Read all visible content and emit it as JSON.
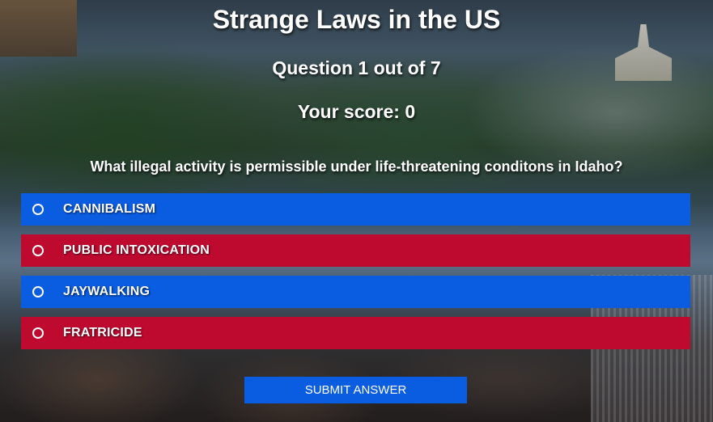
{
  "quiz": {
    "title": "Strange Laws in the US",
    "question_count": "Question 1 out of 7",
    "score": "Your score: 0",
    "question": "What illegal activity is permissible under life-threatening conditons in Idaho?",
    "options": [
      {
        "label": "CANNIBALISM",
        "color": "#0a5ce0"
      },
      {
        "label": "PUBLIC INTOXICATION",
        "color": "#bf0a30"
      },
      {
        "label": "JAYWALKING",
        "color": "#0a5ce0"
      },
      {
        "label": "FRATRICIDE",
        "color": "#bf0a30"
      }
    ],
    "submit_label": "SUBMIT ANSWER"
  },
  "colors": {
    "blue": "#0a5ce0",
    "red": "#bf0a30",
    "text": "#ffffff"
  }
}
